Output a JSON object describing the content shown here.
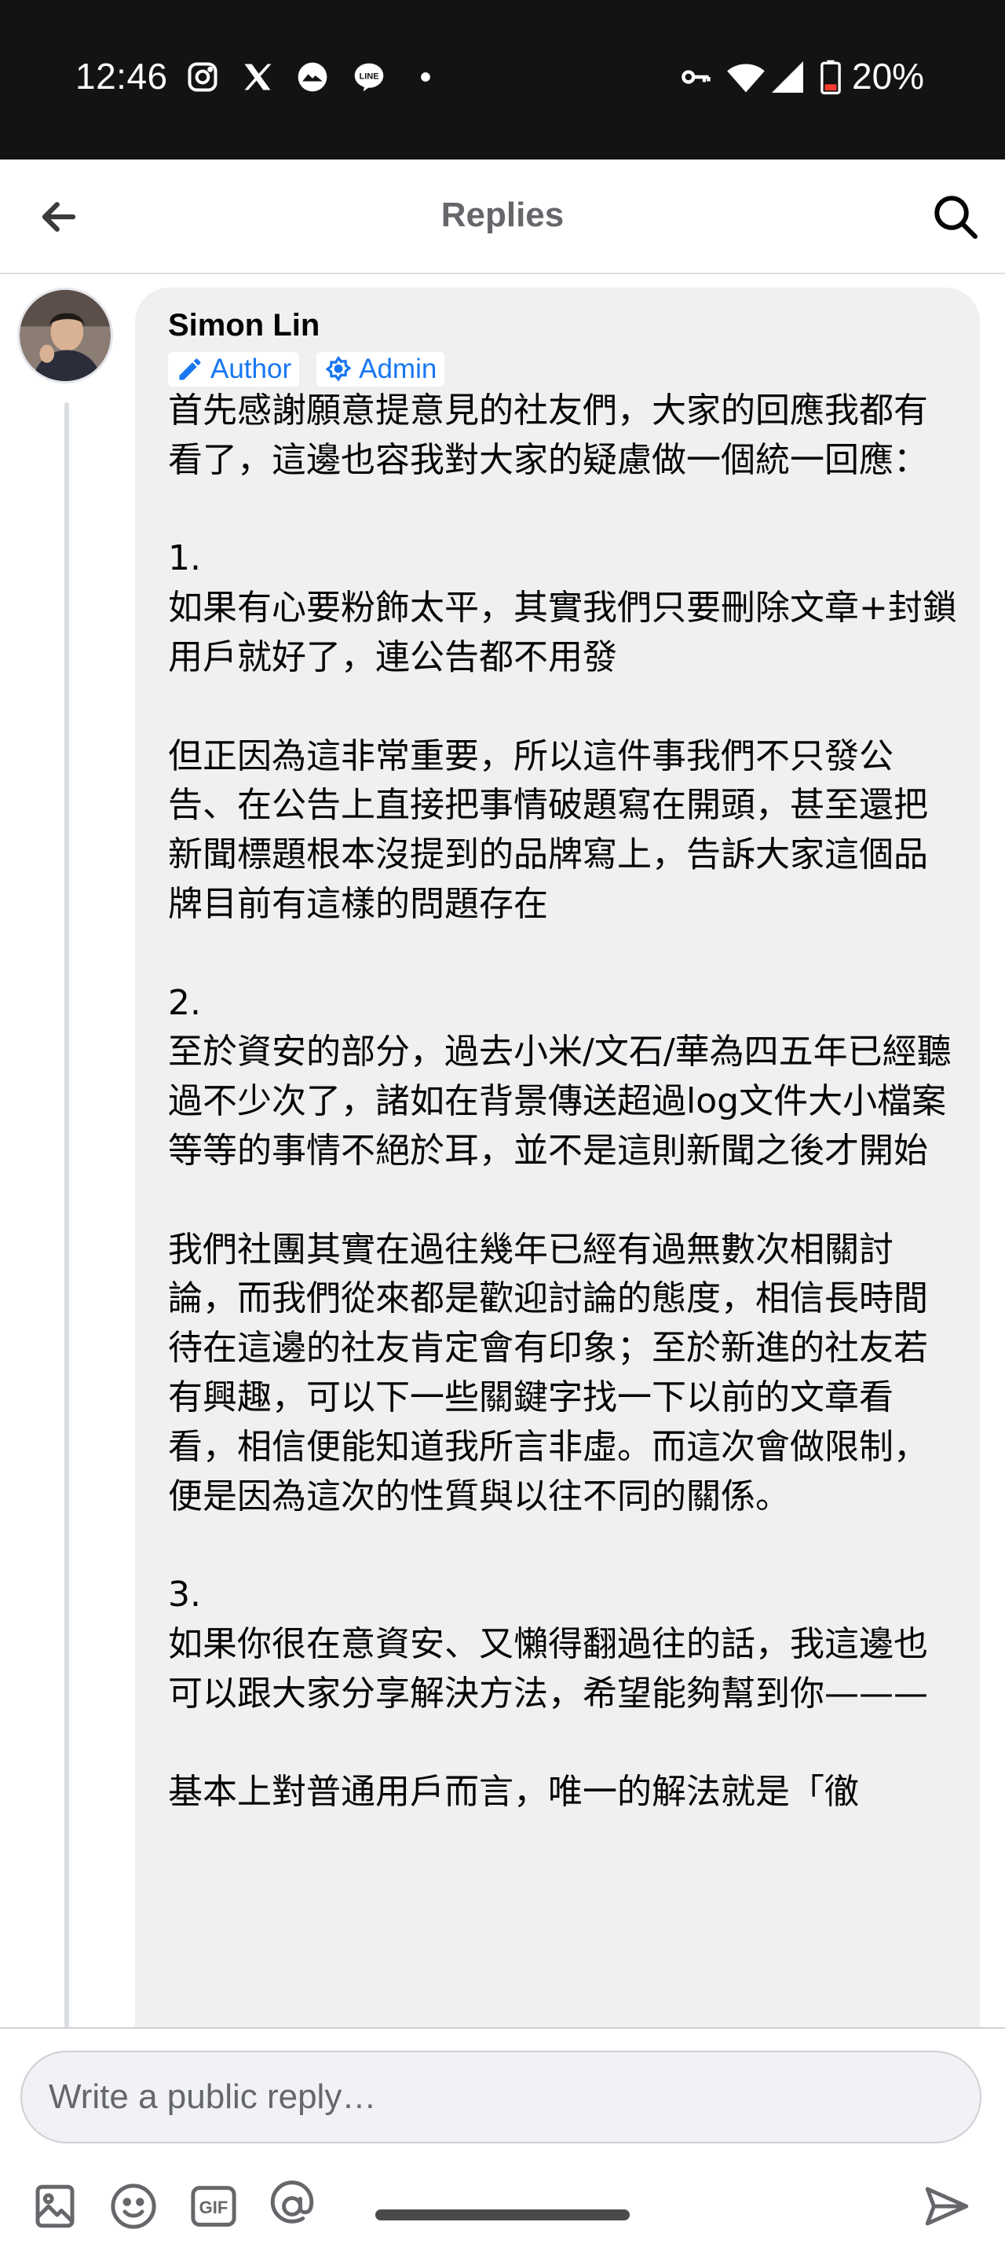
{
  "status_bar": {
    "time": "12:46",
    "battery": "20%",
    "left_icons": [
      "instagram-icon",
      "x-icon",
      "weather-icon",
      "line-icon",
      "dot-icon"
    ],
    "right_icons": [
      "vpn-key-icon",
      "wifi-icon",
      "cell-signal-icon",
      "battery-icon"
    ]
  },
  "header": {
    "title": "Replies",
    "back_icon": "arrow-left-icon",
    "search_icon": "search-icon"
  },
  "comment": {
    "author": "Simon Lin",
    "badges": [
      "Author",
      "Admin"
    ],
    "paragraphs": [
      "首先感謝願意提意見的社友們，大家的回應我都有看了，這邊也容我對大家的疑慮做一個統一回應：",
      "1.\n如果有心要粉飾太平，其實我們只要刪除文章+封鎖用戶就好了，連公告都不用發",
      "但正因為這非常重要，所以這件事我們不只發公告、在公告上直接把事情破題寫在開頭，甚至還把新聞標題根本沒提到的品牌寫上，告訴大家這個品牌目前有這樣的問題存在",
      "2.\n至於資安的部分，過去小米/文石/華為四五年已經聽過不少次了，諸如在背景傳送超過log文件大小檔案等等的事情不絕於耳，並不是這則新聞之後才開始",
      "我們社團其實在過往幾年已經有過無數次相關討論，而我們從來都是歡迎討論的態度，相信長時間待在這邊的社友肯定會有印象；至於新進的社友若有興趣，可以下一些關鍵字找一下以前的文章看看，相信便能知道我所言非虛。而這次會做限制，便是因為這次的性質與以往不同的關係。",
      "3.\n如果你很在意資安、又懶得翻過往的話，我這邊也可以跟大家分享解決方法，希望能夠幫到你———",
      "基本上對普通用戶而言，唯一的解法就是「徹"
    ]
  },
  "composer": {
    "placeholder": "Write a public reply…",
    "tools": [
      "photo-icon",
      "emoji-icon",
      "gif-icon",
      "mention-icon"
    ],
    "send_icon": "send-icon"
  },
  "colors": {
    "status_bar_bg": "#131313",
    "bubble_bg": "#eff0f2",
    "badge_blue": "#1877f2",
    "title_gray": "#65676b"
  }
}
